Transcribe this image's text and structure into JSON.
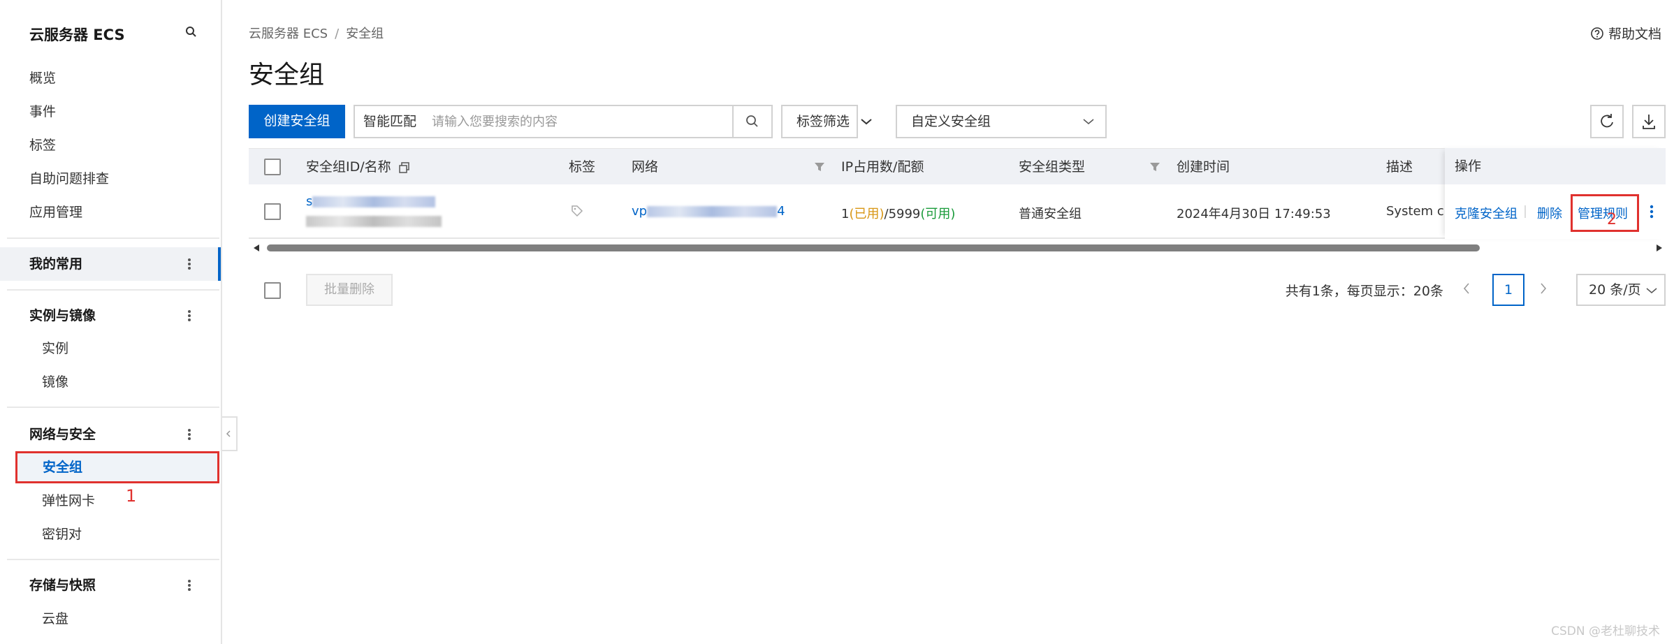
{
  "sidebar": {
    "title": "云服务器 ECS",
    "top_items": [
      "概览",
      "事件",
      "标签",
      "自助问题排查",
      "应用管理"
    ],
    "favorites_label": "我的常用",
    "groups": [
      {
        "label": "实例与镜像",
        "items": [
          "实例",
          "镜像"
        ]
      },
      {
        "label": "网络与安全",
        "items": [
          "安全组",
          "弹性网卡",
          "密钥对"
        ]
      },
      {
        "label": "存储与快照",
        "items": [
          "云盘"
        ]
      }
    ],
    "annotation": "1"
  },
  "breadcrumb": {
    "root": "云服务器 ECS",
    "separator": "/",
    "current": "安全组"
  },
  "help_label": "帮助文档",
  "page_title": "安全组",
  "toolbar": {
    "create_label": "创建安全组",
    "search_mode": "智能匹配",
    "search_placeholder": "请输入您要搜索的内容",
    "tag_filter_label": "标签筛选",
    "group_type_label": "自定义安全组"
  },
  "table": {
    "columns": {
      "id_name": "安全组ID/名称",
      "tag": "标签",
      "network": "网络",
      "ip_usage": "IP占用数/配额",
      "type": "安全组类型",
      "created": "创建时间",
      "description": "描述",
      "actions": "操作"
    },
    "rows": [
      {
        "id_prefix": "s",
        "network_prefix": "vp",
        "network_suffix": "4",
        "ip_used_count": "1",
        "ip_used_label": "(已用)",
        "ip_quota": "/5999",
        "ip_available_label": "(可用)",
        "type": "普通安全组",
        "created": "2024年4月30日 17:49:53",
        "description": "System cre",
        "actions": {
          "clone": "克隆安全组",
          "delete": "删除",
          "manage": "管理规则"
        }
      }
    ],
    "action_annotation": "2"
  },
  "footer": {
    "batch_delete_label": "批量删除",
    "total_text": "共有1条，每页显示：20条",
    "current_page": "1",
    "page_size_label": "20 条/页"
  },
  "watermark": "CSDN @老杜聊技术",
  "colors": {
    "primary": "#0064c8",
    "annotation": "#e0312e",
    "used": "#d89614",
    "available": "#1a9b3a"
  }
}
